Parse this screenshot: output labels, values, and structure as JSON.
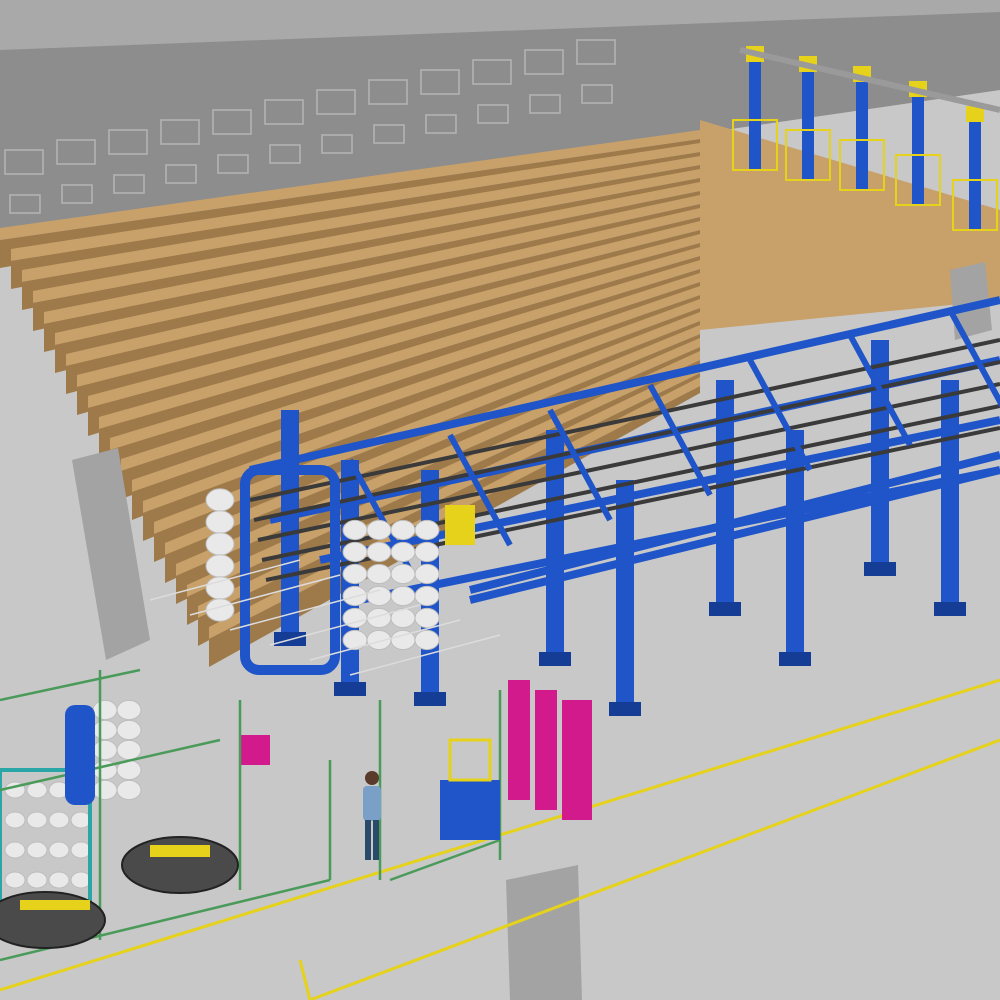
{
  "scene": {
    "colors": {
      "floor": "#c8c8c8",
      "wall": "#8d8d8d",
      "roof": "#a9a9a9",
      "creel_bars": "#c8a06a",
      "creel_bars_shadow": "#9e7a4a",
      "frame_blue": "#1f55c8",
      "frame_blue_dark": "#153d96",
      "belt": "#3a3a3a",
      "safety_yellow": "#e6d21a",
      "fence_green": "#4a9a5a",
      "panel_magenta": "#d21a8c",
      "bobbin_white": "#e9e9e9",
      "pillar": "#a3a3a3",
      "teal_rack": "#2aa6a6"
    }
  }
}
